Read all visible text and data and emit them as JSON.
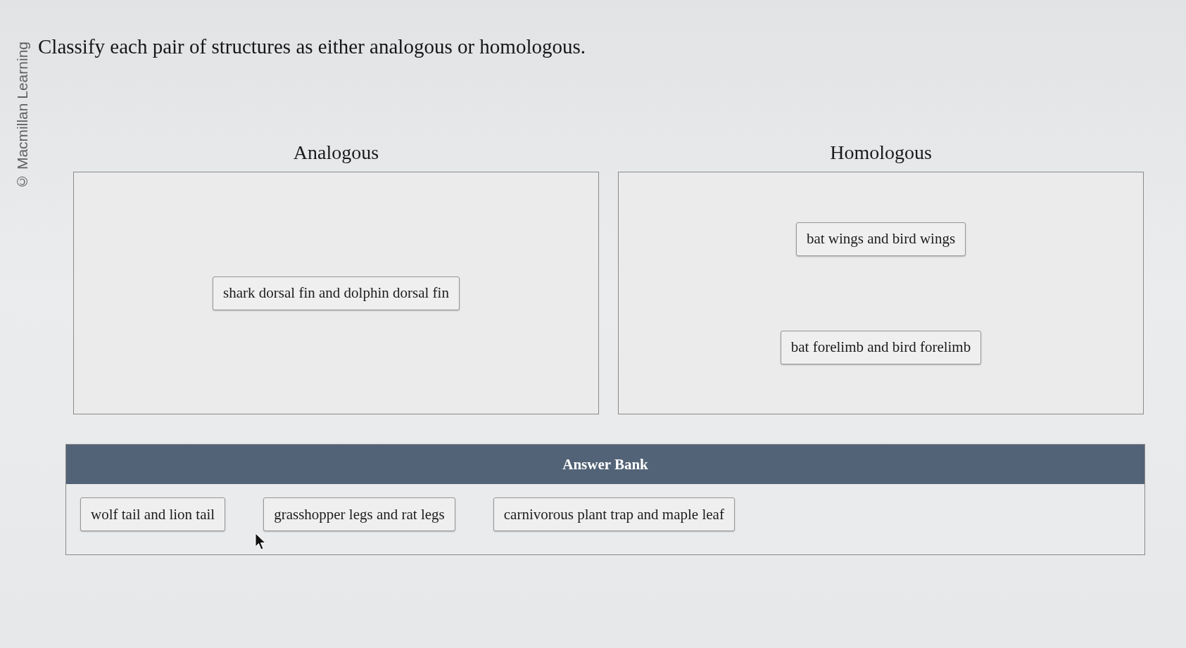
{
  "credit": "© Macmillan Learning",
  "question": "Classify each pair of structures as either analogous or homologous.",
  "zones": [
    {
      "heading": "Analogous",
      "items": [
        "shark dorsal fin and dolphin dorsal fin"
      ]
    },
    {
      "heading": "Homologous",
      "items": [
        "bat wings and bird wings",
        "bat forelimb and bird forelimb"
      ]
    }
  ],
  "answer_bank": {
    "title": "Answer Bank",
    "items": [
      "wolf tail and lion tail",
      "grasshopper legs and rat legs",
      "carnivorous plant trap and maple leaf"
    ]
  }
}
